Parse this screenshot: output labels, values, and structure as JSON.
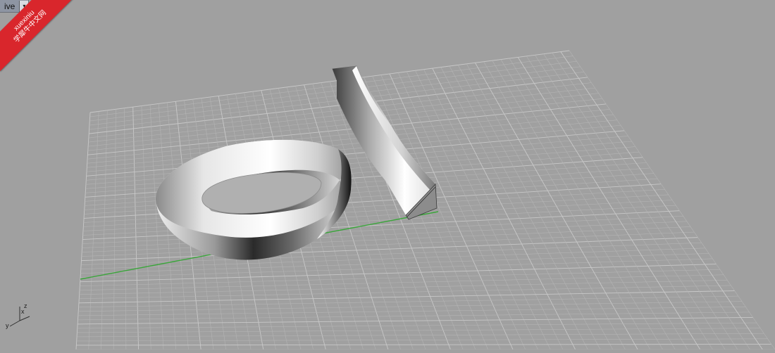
{
  "viewport": {
    "title": "Perspective",
    "title_visible": "ive",
    "dropdown_glyph": "▾"
  },
  "watermark": {
    "line1": "xuexiniu",
    "line2": "学犀牛中文网",
    "color": "#d9262c"
  },
  "axes": {
    "x_label": "x",
    "y_label": "y",
    "z_label": "z",
    "x_axis_color": "#3aa53a"
  },
  "colors": {
    "background": "#a0a0a0",
    "grid_minor": "#b4b4b4",
    "grid_major": "#c8c8c8",
    "surface_light": "#ffffff",
    "surface_dark": "#1a1a1a"
  },
  "scene": {
    "objects": [
      "mobius-strip",
      "twisted-bar"
    ]
  }
}
